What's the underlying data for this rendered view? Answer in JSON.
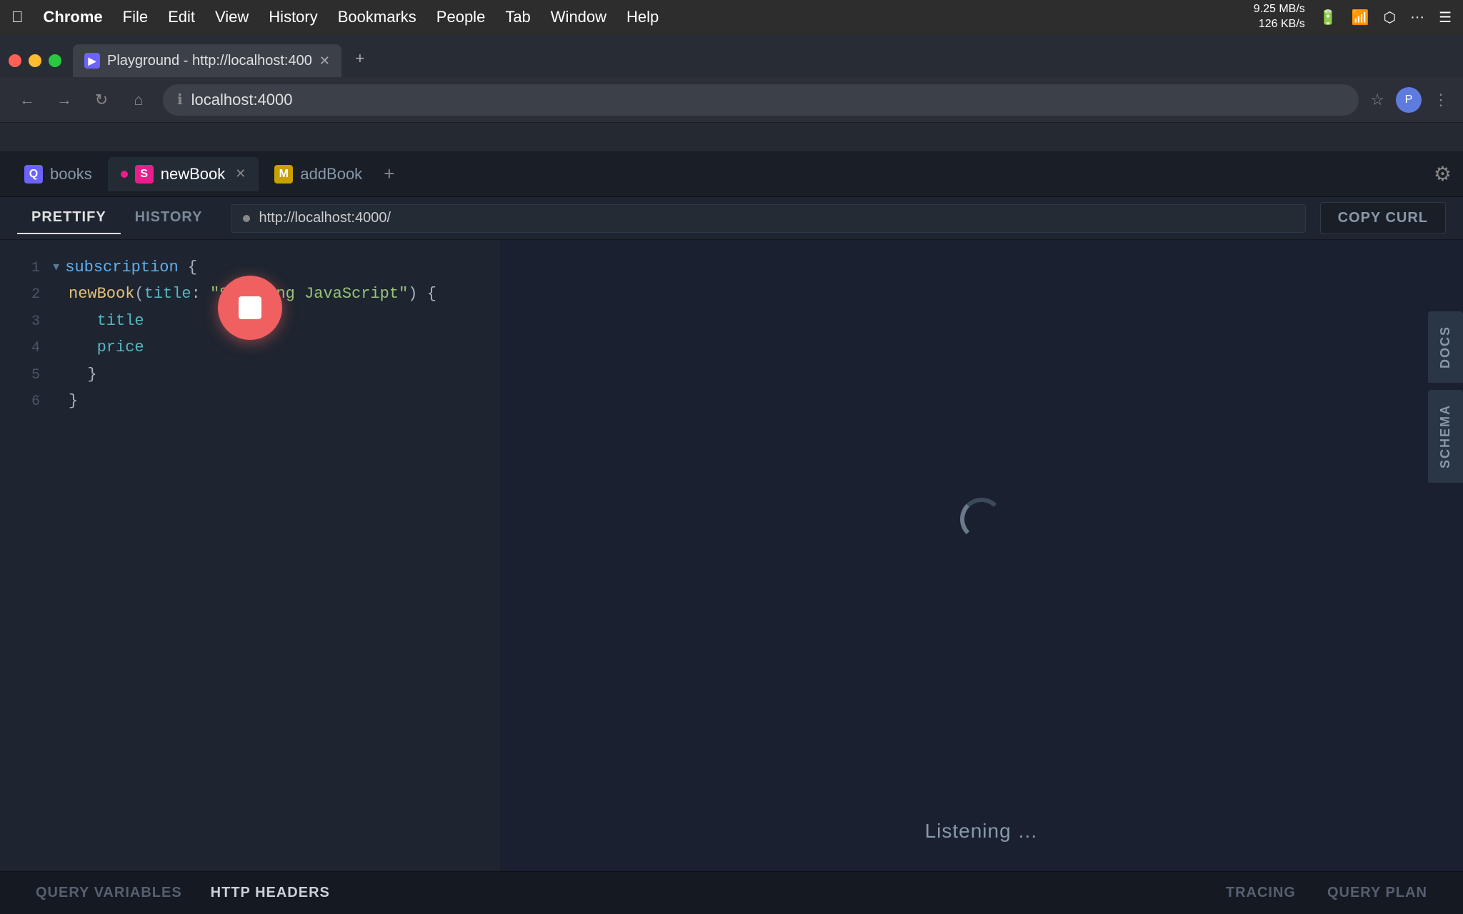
{
  "macos": {
    "menu_items": [
      "",
      "Chrome",
      "File",
      "Edit",
      "View",
      "History",
      "Bookmarks",
      "People",
      "Tab",
      "Window",
      "Help"
    ],
    "network_up": "9.25 MB/s",
    "network_down": "126 KB/s",
    "battery": "🔋",
    "wifi": "📶"
  },
  "browser": {
    "tab_title": "Playground - http://localhost:400",
    "tab_favicon": "▶",
    "url": "localhost:4000",
    "full_url": "http://localhost:4000/"
  },
  "playground": {
    "tabs": [
      {
        "icon": "Q",
        "icon_class": "tab-icon-q",
        "label": "books",
        "active": false,
        "closable": false,
        "dot": false
      },
      {
        "icon": "S",
        "icon_class": "tab-icon-s",
        "label": "newBook",
        "active": true,
        "closable": true,
        "dot": true
      },
      {
        "icon": "M",
        "icon_class": "tab-icon-m",
        "label": "addBook",
        "active": false,
        "closable": false,
        "dot": false
      }
    ],
    "toolbar": {
      "prettify_label": "PRETTIFY",
      "history_label": "HISTORY",
      "url": "http://localhost:4000/",
      "copy_curl_label": "COPY CURL"
    },
    "code": {
      "lines": [
        {
          "num": "1",
          "fold": true,
          "content": "subscription {",
          "tokens": [
            {
              "text": "subscription",
              "class": "kw-subscription"
            },
            {
              "text": " {",
              "class": "kw-punct"
            }
          ]
        },
        {
          "num": "2",
          "fold": false,
          "content": "  newBook(title: \"Speaking JavaScript\") {",
          "tokens": [
            {
              "text": "  ",
              "class": ""
            },
            {
              "text": "newBook",
              "class": "kw-field"
            },
            {
              "text": "(",
              "class": "kw-punct"
            },
            {
              "text": "title",
              "class": "kw-title"
            },
            {
              "text": ": ",
              "class": "kw-punct"
            },
            {
              "text": "\"Speaking JavaScript\"",
              "class": "kw-string"
            },
            {
              "text": ") {",
              "class": "kw-punct"
            }
          ]
        },
        {
          "num": "3",
          "fold": false,
          "content": "    title",
          "tokens": [
            {
              "text": "    title",
              "class": "kw-title"
            }
          ]
        },
        {
          "num": "4",
          "fold": false,
          "content": "    price",
          "tokens": [
            {
              "text": "    price",
              "class": "kw-price"
            }
          ]
        },
        {
          "num": "5",
          "fold": false,
          "content": "  }",
          "tokens": [
            {
              "text": "  }",
              "class": "kw-punct"
            }
          ]
        },
        {
          "num": "6",
          "fold": false,
          "content": "}",
          "tokens": [
            {
              "text": "}",
              "class": "kw-punct"
            }
          ]
        }
      ]
    },
    "result": {
      "listening_text": "Listening …"
    },
    "side_tabs": [
      "DOCS",
      "SCHEMA"
    ],
    "bottom_tabs": [
      "QUERY VARIABLES",
      "HTTP HEADERS"
    ],
    "bottom_right_tabs": [
      "TRACING",
      "QUERY PLAN"
    ]
  }
}
